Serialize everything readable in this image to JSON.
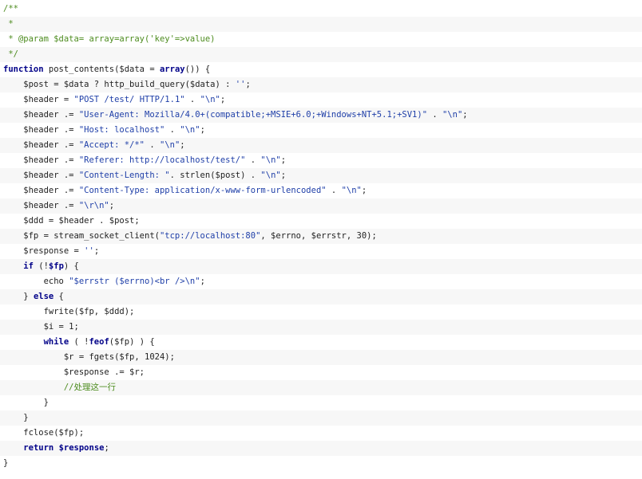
{
  "code_lines": [
    [
      {
        "t": "c",
        "x": "/**"
      }
    ],
    [
      {
        "t": "c",
        "x": " *"
      }
    ],
    [
      {
        "t": "c",
        "x": " * @param $data= array=array('key'=>value)"
      }
    ],
    [
      {
        "t": "c",
        "x": " */"
      }
    ],
    [
      {
        "t": "k",
        "x": "function"
      },
      {
        "t": "v",
        "x": " post_contents($data = "
      },
      {
        "t": "k",
        "x": "array"
      },
      {
        "t": "v",
        "x": "()) {"
      }
    ],
    [
      {
        "t": "v",
        "x": "    $post = $data ? http_build_query($data) : "
      },
      {
        "t": "s",
        "x": "''"
      },
      {
        "t": "v",
        "x": ";"
      }
    ],
    [
      {
        "t": "v",
        "x": "    $header = "
      },
      {
        "t": "s",
        "x": "\"POST /test/ HTTP/1.1\""
      },
      {
        "t": "v",
        "x": " . "
      },
      {
        "t": "s",
        "x": "\"\\n\""
      },
      {
        "t": "v",
        "x": ";"
      }
    ],
    [
      {
        "t": "v",
        "x": "    $header .= "
      },
      {
        "t": "s",
        "x": "\"User-Agent: Mozilla/4.0+(compatible;+MSIE+6.0;+Windows+NT+5.1;+SV1)\""
      },
      {
        "t": "v",
        "x": " . "
      },
      {
        "t": "s",
        "x": "\"\\n\""
      },
      {
        "t": "v",
        "x": ";"
      }
    ],
    [
      {
        "t": "v",
        "x": "    $header .= "
      },
      {
        "t": "s",
        "x": "\"Host: localhost\""
      },
      {
        "t": "v",
        "x": " . "
      },
      {
        "t": "s",
        "x": "\"\\n\""
      },
      {
        "t": "v",
        "x": ";"
      }
    ],
    [
      {
        "t": "v",
        "x": "    $header .= "
      },
      {
        "t": "s",
        "x": "\"Accept: */*\""
      },
      {
        "t": "v",
        "x": " . "
      },
      {
        "t": "s",
        "x": "\"\\n\""
      },
      {
        "t": "v",
        "x": ";"
      }
    ],
    [
      {
        "t": "v",
        "x": "    $header .= "
      },
      {
        "t": "s",
        "x": "\"Referer: http://localhost/test/\""
      },
      {
        "t": "v",
        "x": " . "
      },
      {
        "t": "s",
        "x": "\"\\n\""
      },
      {
        "t": "v",
        "x": ";"
      }
    ],
    [
      {
        "t": "v",
        "x": "    $header .= "
      },
      {
        "t": "s",
        "x": "\"Content-Length: \""
      },
      {
        "t": "v",
        "x": ". strlen($post) . "
      },
      {
        "t": "s",
        "x": "\"\\n\""
      },
      {
        "t": "v",
        "x": ";"
      }
    ],
    [
      {
        "t": "v",
        "x": "    $header .= "
      },
      {
        "t": "s",
        "x": "\"Content-Type: application/x-www-form-urlencoded\""
      },
      {
        "t": "v",
        "x": " . "
      },
      {
        "t": "s",
        "x": "\"\\n\""
      },
      {
        "t": "v",
        "x": ";"
      }
    ],
    [
      {
        "t": "v",
        "x": "    $header .= "
      },
      {
        "t": "s",
        "x": "\"\\r\\n\""
      },
      {
        "t": "v",
        "x": ";"
      }
    ],
    [
      {
        "t": "v",
        "x": "    $ddd = $header . $post;"
      }
    ],
    [
      {
        "t": "v",
        "x": "    $fp = stream_socket_client("
      },
      {
        "t": "s",
        "x": "\"tcp://localhost:80\""
      },
      {
        "t": "v",
        "x": ", $errno, $errstr, 30);"
      }
    ],
    [
      {
        "t": "v",
        "x": "    $response = "
      },
      {
        "t": "s",
        "x": "''"
      },
      {
        "t": "v",
        "x": ";"
      }
    ],
    [
      {
        "t": "v",
        "x": "    "
      },
      {
        "t": "k",
        "x": "if"
      },
      {
        "t": "v",
        "x": " (!"
      },
      {
        "t": "k",
        "x": "$fp"
      },
      {
        "t": "v",
        "x": ") {"
      }
    ],
    [
      {
        "t": "v",
        "x": "        echo "
      },
      {
        "t": "s",
        "x": "\"$errstr ($errno)<br />\\n\""
      },
      {
        "t": "v",
        "x": ";"
      }
    ],
    [
      {
        "t": "v",
        "x": "    } "
      },
      {
        "t": "k",
        "x": "else"
      },
      {
        "t": "v",
        "x": " {"
      }
    ],
    [
      {
        "t": "v",
        "x": "        fwrite($fp, $ddd);"
      }
    ],
    [
      {
        "t": "v",
        "x": "        $i = 1;"
      }
    ],
    [
      {
        "t": "v",
        "x": "        "
      },
      {
        "t": "k",
        "x": "while"
      },
      {
        "t": "v",
        "x": " ( !"
      },
      {
        "t": "k",
        "x": "feof"
      },
      {
        "t": "v",
        "x": "($fp) ) {"
      }
    ],
    [
      {
        "t": "v",
        "x": "            $r = fgets($fp, 1024);"
      }
    ],
    [
      {
        "t": "v",
        "x": "            $response .= $r;"
      }
    ],
    [
      {
        "t": "c",
        "x": "            //处理这一行"
      }
    ],
    [
      {
        "t": "v",
        "x": "        }"
      }
    ],
    [
      {
        "t": "v",
        "x": "    }"
      }
    ],
    [
      {
        "t": "v",
        "x": "    fclose($fp);"
      }
    ],
    [
      {
        "t": "v",
        "x": "    "
      },
      {
        "t": "k",
        "x": "return"
      },
      {
        "t": "v",
        "x": " "
      },
      {
        "t": "k",
        "x": "$response"
      },
      {
        "t": "v",
        "x": ";"
      }
    ],
    [
      {
        "t": "v",
        "x": "}"
      }
    ]
  ]
}
